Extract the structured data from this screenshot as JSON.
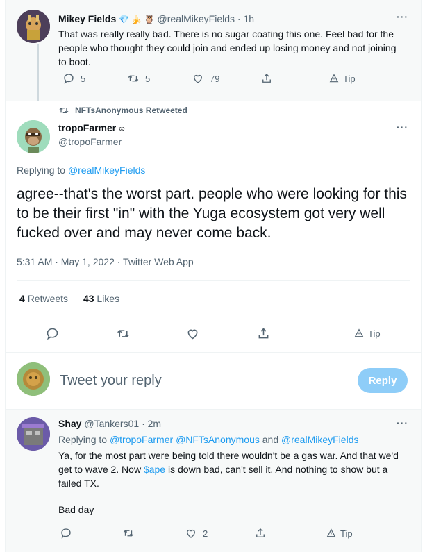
{
  "top_tweet": {
    "name": "Mikey Fields",
    "name_emoji": "💎 🍌 🦉",
    "handle": "@realMikeyFields",
    "time": "· 1h",
    "text": "That was really really bad. There is no sugar coating this one.  Feel bad for the people who thought they could join and ended up losing money and not joining to boot.",
    "replies": "5",
    "retweets": "5",
    "likes": "79",
    "tip": "Tip"
  },
  "retweet_context": "NFTsAnonymous Retweeted",
  "main_tweet": {
    "name": "tropoFarmer",
    "name_suffix": "∞",
    "handle": "@tropoFarmer",
    "replying_prefix": "Replying to",
    "replying_to": "@realMikeyFields",
    "text": "agree--that's the worst part. people who were looking for this to be their first \"in\" with the Yuga ecosystem got very well fucked over and may never come back.",
    "timestamp": "5:31 AM · May 1, 2022 · Twitter Web App",
    "retweets_count": "4",
    "retweets_label": "Retweets",
    "likes_count": "43",
    "likes_label": "Likes",
    "tip": "Tip"
  },
  "composer": {
    "placeholder": "Tweet your reply",
    "reply_button": "Reply"
  },
  "reply_tweet": {
    "name": "Shay",
    "handle": "@Tankers01",
    "time": "· 2m",
    "replying_prefix": "Replying to",
    "replying_to_1": "@tropoFarmer",
    "replying_to_2": "@NFTsAnonymous",
    "replying_and": "and",
    "replying_to_3": "@realMikeyFields",
    "text_1": "Ya, for the most part were being told there wouldn't be a gas war. And that we'd get to wave 2. Now ",
    "cashtag": "$ape",
    "text_2": " is down bad, can't sell it. And nothing to show but a failed TX.",
    "text_3": "Bad day",
    "likes": "2",
    "tip": "Tip"
  },
  "colors": {
    "accent": "#1d9bf0",
    "muted": "#536471",
    "reply_button": "#8ecdf8"
  }
}
